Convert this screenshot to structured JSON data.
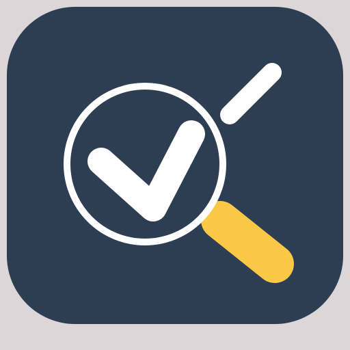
{
  "app_icon": {
    "icon_name": "search-check-icon",
    "colors": {
      "page_background": "#dcd6d8",
      "tile": "#2e3e52",
      "glyph": "#ffffff",
      "handle_accent": "#f9c846"
    }
  }
}
